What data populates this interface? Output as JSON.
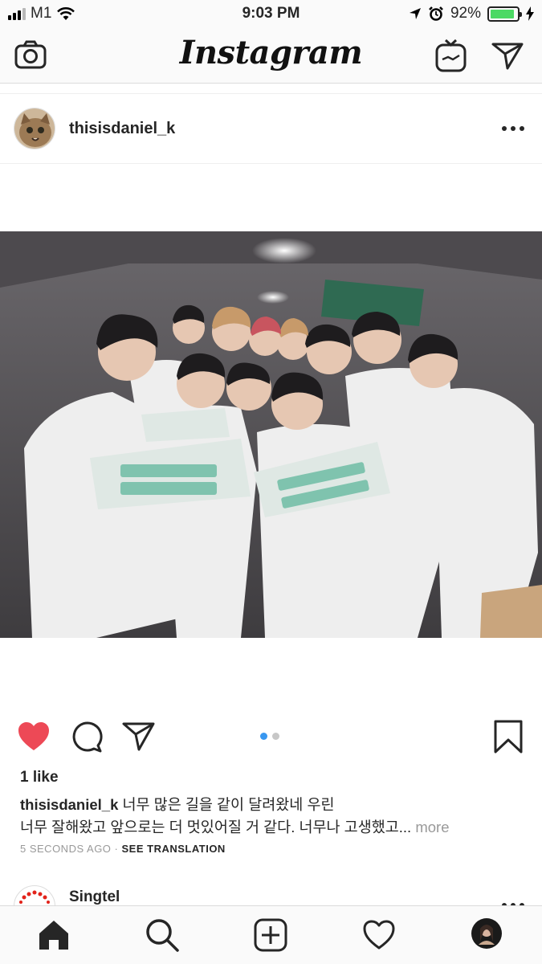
{
  "status_bar": {
    "carrier": "M1",
    "time": "9:03 PM",
    "battery_percent": "92%",
    "battery_level": 0.92,
    "signal_bars": 3,
    "icons": [
      "signal-icon",
      "wifi-icon",
      "location-arrow-icon",
      "alarm-icon",
      "battery-icon",
      "charging-bolt-icon"
    ]
  },
  "header": {
    "logo": "Instagram",
    "icons": [
      "camera-icon",
      "igtv-icon",
      "direct-message-icon"
    ]
  },
  "post": {
    "username": "thisisdaniel_k",
    "avatar_icon": "cat-avatar",
    "media_icon": "group-photo",
    "carousel_dots": 2,
    "carousel_active": 0,
    "liked": true,
    "likes": "1 like",
    "caption_user": "thisisdaniel_k",
    "caption_line1": " 너무 많은 길을 같이 달려왔네 우린",
    "caption_line2": "너무 잘해왔고 앞으로는 더 멋있어질 거 같다. 너무나 고생했고...",
    "caption_more": " more",
    "timestamp": "5 SECONDS AGO",
    "see_translation": "SEE TRANSLATION",
    "action_icons": [
      "heart-icon",
      "comment-icon",
      "share-icon",
      "bookmark-icon"
    ],
    "colors": {
      "heart": "#ed4956",
      "active_dot": "#3897f0",
      "inactive_dot": "#c7c7c7"
    }
  },
  "next_post": {
    "username": "Singtel"
  },
  "tab_bar": {
    "icons": [
      "home-icon",
      "search-icon",
      "add-post-icon",
      "activity-heart-icon",
      "profile-avatar"
    ]
  }
}
